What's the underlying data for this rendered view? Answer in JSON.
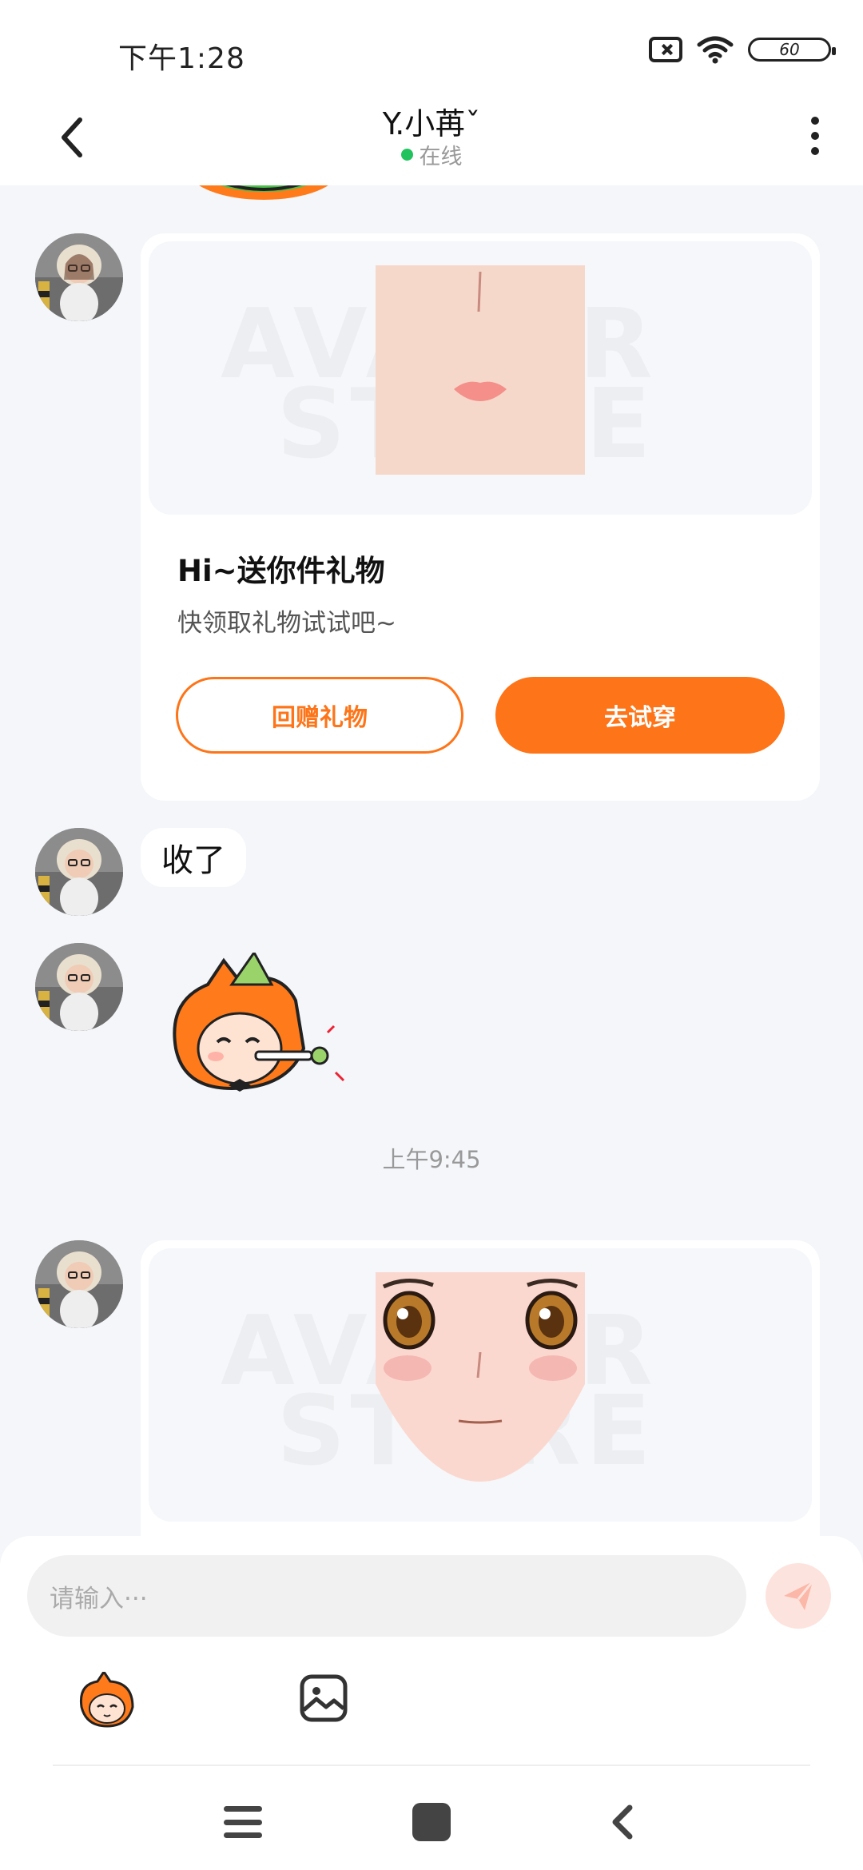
{
  "status_bar": {
    "time": "下午1:28",
    "battery": "60"
  },
  "header": {
    "title": "Y.小苒ˇ",
    "status": "在线"
  },
  "messages": {
    "gift_card_1": {
      "title": "Hi~送你件礼物",
      "subtitle": "快领取礼物试试吧~",
      "return_gift_label": "回赠礼物",
      "try_on_label": "去试穿"
    },
    "text_message": "收了",
    "timestamp": "上午9:45"
  },
  "input": {
    "placeholder": "请输入···"
  },
  "colors": {
    "accent": "#fe7418",
    "online": "#22c35e",
    "background": "#f4f6fa"
  }
}
